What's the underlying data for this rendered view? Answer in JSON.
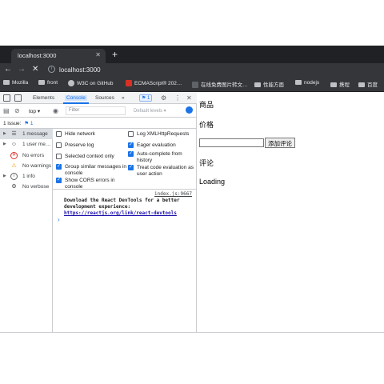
{
  "browser": {
    "tab_title": "localhost:3000",
    "tab_close": "✕",
    "new_tab": "+",
    "url": "localhost:3000",
    "back": "←",
    "forward": "→",
    "stop": "✕",
    "info": "i",
    "bookmarks": [
      "Mozilla",
      "front",
      "W3C on GitHub",
      "ECMAScript® 202…",
      "在线免费图片转文…",
      "性能方面",
      "nodejs",
      "携程",
      "百度"
    ]
  },
  "devtools": {
    "tabs": [
      "Elements",
      "Console",
      "Sources"
    ],
    "more_tabs": "»",
    "issue_badge": "1",
    "context": "top",
    "filter_placeholder": "Filter",
    "default_levels": "Default levels ▾",
    "issues_label": "1 issue:",
    "issues_count": "1",
    "sidebar": [
      {
        "label": "1 message",
        "icon": "list-icon"
      },
      {
        "label": "1 user me…",
        "icon": "user-icon"
      },
      {
        "label": "No errors",
        "icon": "error-icon"
      },
      {
        "label": "No warnings",
        "icon": "warning-icon"
      },
      {
        "label": "1 info",
        "icon": "info-icon"
      },
      {
        "label": "No verbose",
        "icon": "verbose-icon"
      }
    ],
    "settings": {
      "hide_network": "Hide network",
      "preserve_log": "Preserve log",
      "selected_context": "Selected context only",
      "group_similar": "Group similar messages in console",
      "show_cors": "Show CORS errors in console",
      "log_xhr": "Log XMLHttpRequests",
      "eager_eval": "Eager evaluation",
      "autocomplete": "Auto-complete from history",
      "treat_code": "Treat code evaluation as user action"
    },
    "log": {
      "source": "index.js:9667",
      "message": "Download the React DevTools for a better development experience: ",
      "link": "https://reactjs.org/link/react-devtools"
    },
    "prompt": "›"
  },
  "page": {
    "goods_label": "商品",
    "price_label": "价格",
    "input_value": "",
    "add_comment_button": "添加评论",
    "comments_label": "评论",
    "loading_text": "Loading"
  }
}
